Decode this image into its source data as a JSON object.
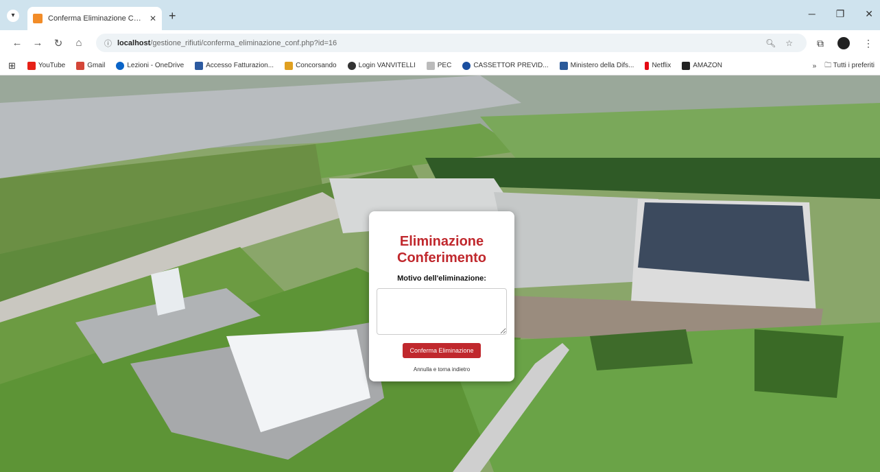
{
  "browser": {
    "tab_title": "Conferma Eliminazione Confer...",
    "url_host": "localhost",
    "url_path": "/gestione_rifiuti/conferma_eliminazione_conf.php?id=16",
    "bookmarks": [
      {
        "label": "YouTube",
        "color": "#e62117"
      },
      {
        "label": "Gmail",
        "color": "#d44638"
      },
      {
        "label": "Lezioni - OneDrive",
        "color": "#0a64c8"
      },
      {
        "label": "Accesso Fatturazion...",
        "color": "#2c5aa0"
      },
      {
        "label": "Concorsando",
        "color": "#e0a020"
      },
      {
        "label": "Login VANVITELLI",
        "color": "#333333"
      },
      {
        "label": "PEC",
        "color": "#888888"
      },
      {
        "label": "CASSETTOR PREVID...",
        "color": "#1b4fa0"
      },
      {
        "label": "Ministero della Difs...",
        "color": "#2b5a9a"
      },
      {
        "label": "Netflix",
        "color": "#e50914"
      },
      {
        "label": "AMAZON",
        "color": "#222222"
      }
    ],
    "all_bookmarks_label": "Tutti i preferiti",
    "more_label": "»"
  },
  "modal": {
    "title": "Eliminazione Conferimento",
    "reason_label": "Motivo dell'eliminazione:",
    "reason_value": "",
    "confirm_label": "Conferma Eliminazione",
    "cancel_label": "Annulla e torna indietro",
    "accent_color": "#c0282d"
  }
}
